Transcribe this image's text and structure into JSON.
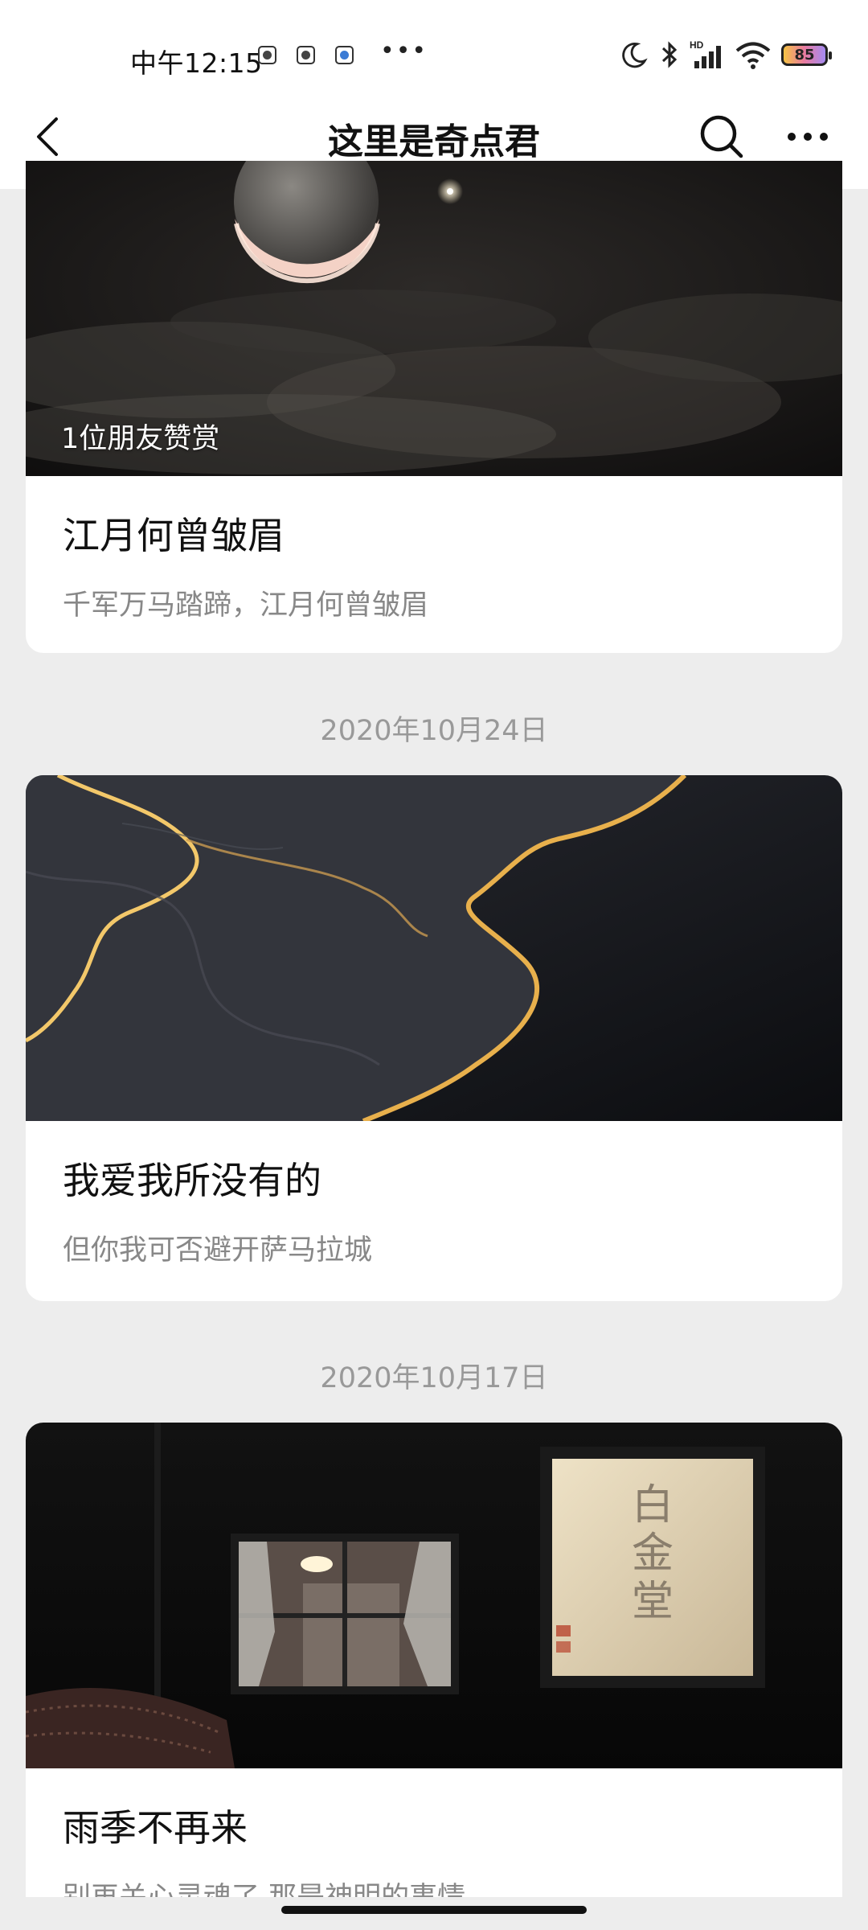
{
  "status_bar": {
    "time": "中午12:15",
    "more_dots": "•••",
    "battery_level": "85"
  },
  "nav": {
    "title": "这里是奇点君"
  },
  "posts": [
    {
      "reward_text": "1位朋友赞赏",
      "title": "江月何曾皱眉",
      "description": "千军万马踏蹄，江月何曾皱眉"
    },
    {
      "date": "2020年10月24日",
      "title": "我爱我所没有的",
      "description": "但你我可否避开萨马拉城"
    },
    {
      "date": "2020年10月17日",
      "title": "雨季不再来",
      "description": "别再关心灵魂了 那是神明的事情"
    }
  ]
}
